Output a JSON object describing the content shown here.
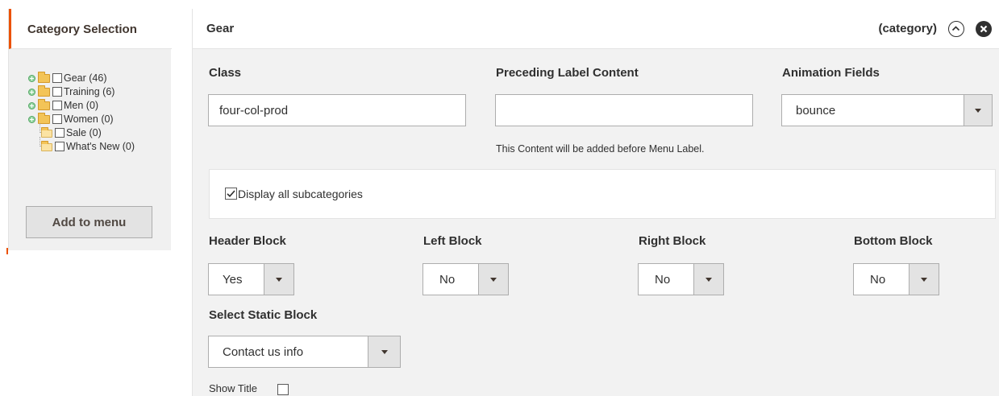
{
  "sidebar": {
    "title": "Category Selection",
    "tree": [
      {
        "label": "Gear (46)",
        "expandable": true
      },
      {
        "label": "Training (6)",
        "expandable": true
      },
      {
        "label": "Men (0)",
        "expandable": true
      },
      {
        "label": "Women (0)",
        "expandable": true
      },
      {
        "label": "Sale (0)",
        "expandable": false
      },
      {
        "label": "What's New (0)",
        "expandable": false
      }
    ],
    "add_button": "Add to menu"
  },
  "panel": {
    "title": "Gear",
    "type_label": "(category)",
    "icons": [
      "chevron-up-circle-icon",
      "close-circle-icon"
    ],
    "class_label": "Class",
    "class_value": "four-col-prod",
    "preceding_label": "Preceding Label Content",
    "preceding_value": "",
    "preceding_note": "This Content will be added before Menu Label.",
    "animation_label": "Animation Fields",
    "animation_value": "bounce",
    "display_all_label": "Display all subcategories",
    "display_all_checked": true,
    "header_block_label": "Header Block",
    "header_block_value": "Yes",
    "left_block_label": "Left Block",
    "left_block_value": "No",
    "right_block_label": "Right Block",
    "right_block_value": "No",
    "bottom_block_label": "Bottom Block",
    "bottom_block_value": "No",
    "static_block_label": "Select Static Block",
    "static_block_value": "Contact us info",
    "show_title_label": "Show Title",
    "show_title_checked": false
  },
  "colors": {
    "accent": "#eb5202",
    "panel_bg": "#f2f2f2",
    "button_bg": "#e3e3e3",
    "border": "#adadad"
  }
}
